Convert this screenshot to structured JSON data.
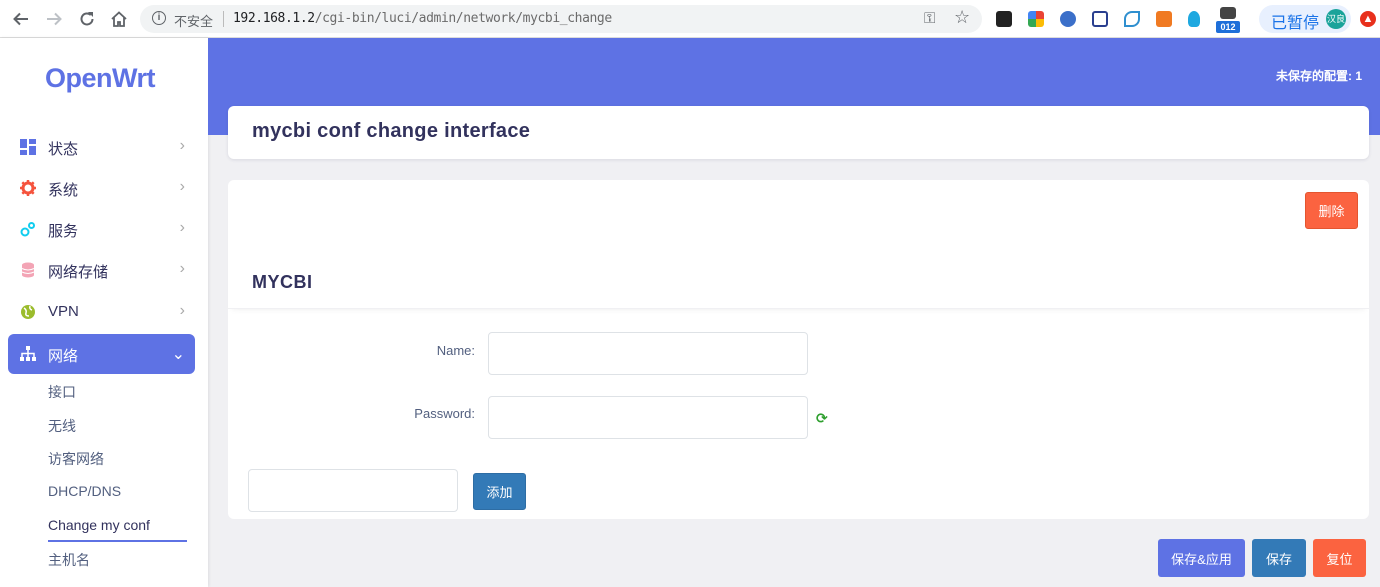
{
  "browser": {
    "security_label": "不安全",
    "url_host": "192.168.1.2",
    "url_path": "/cgi-bin/luci/admin/network/mycbi_change",
    "extension_badge": "012",
    "profile_status": "已暂停",
    "profile_avatar_text": "汉良"
  },
  "sidebar": {
    "logo": "OpenWrt",
    "menu": [
      {
        "label": "状态",
        "icon": "dashboard-icon"
      },
      {
        "label": "系统",
        "icon": "gear-icon"
      },
      {
        "label": "服务",
        "icon": "cogs-icon"
      },
      {
        "label": "网络存储",
        "icon": "database-icon"
      },
      {
        "label": "VPN",
        "icon": "globe-icon"
      },
      {
        "label": "网络",
        "icon": "sitemap-icon"
      }
    ],
    "submenu": [
      "接口",
      "无线",
      "访客网络",
      "DHCP/DNS",
      "Change my conf",
      "主机名"
    ]
  },
  "header": {
    "unsaved_text": "未保存的配置: 1"
  },
  "page": {
    "title": "mycbi conf change interface",
    "section_title": "MYCBI",
    "delete_label": "删除",
    "fields": {
      "name_label": "Name:",
      "password_label": "Password:"
    },
    "add_label": "添加"
  },
  "footer": {
    "save_apply_label": "保存&应用",
    "save_label": "保存",
    "reset_label": "复位"
  },
  "colors": {
    "primary": "#5e72e4",
    "danger": "#fb6340",
    "info": "#337ab7"
  }
}
